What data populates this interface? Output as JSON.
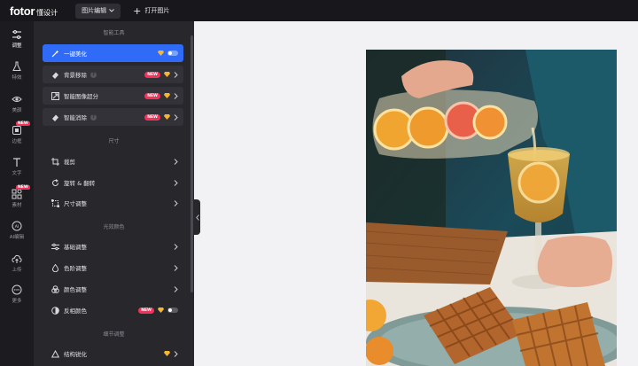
{
  "topbar": {
    "logo": "fotor",
    "logo_sub": "懂设计",
    "mode_label": "图片编辑",
    "open_label": "打开图片"
  },
  "rail": {
    "items": [
      {
        "label": "调整",
        "icon": "sliders-icon",
        "active": true
      },
      {
        "label": "特效",
        "icon": "flask-icon"
      },
      {
        "label": "美颜",
        "icon": "eye-icon"
      },
      {
        "label": "边框",
        "icon": "frame-icon",
        "badge": "NEW"
      },
      {
        "label": "文字",
        "icon": "text-icon"
      },
      {
        "label": "素材",
        "icon": "shapes-icon",
        "badge": "NEW"
      },
      {
        "label": "AI编辑",
        "icon": "ai-icon"
      },
      {
        "label": "上传",
        "icon": "upload-cloud-icon"
      },
      {
        "label": "更多",
        "icon": "more-icon"
      }
    ]
  },
  "panel": {
    "sections": {
      "smart": "智能工具",
      "size": "尺寸",
      "color": "光效颜色",
      "detail": "细节调整"
    },
    "rows": {
      "beautify": {
        "label": "一键美化"
      },
      "bg_remove": {
        "label": "背景移除",
        "badge": "NEW"
      },
      "upscale": {
        "label": "智能图像超分",
        "badge": "NEW"
      },
      "erase": {
        "label": "智能消除",
        "badge": "NEW"
      },
      "crop": {
        "label": "裁剪"
      },
      "rotate": {
        "label": "旋转 & 翻转"
      },
      "resize": {
        "label": "尺寸调整"
      },
      "basic": {
        "label": "基础调整"
      },
      "levels": {
        "label": "色阶调整"
      },
      "hsl": {
        "label": "颜色调整"
      },
      "invert": {
        "label": "反相颜色",
        "badge": "NEW"
      },
      "structure": {
        "label": "结构锐化"
      }
    }
  },
  "colors": {
    "accent": "#2f6bf6",
    "new_badge": "#f2325a",
    "gem": "#f5b632"
  }
}
